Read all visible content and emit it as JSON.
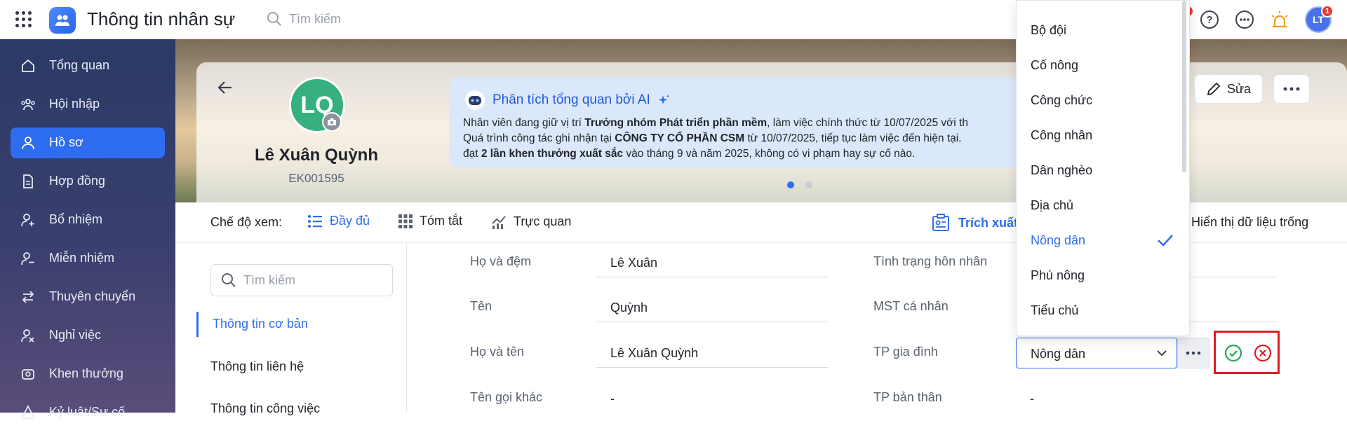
{
  "app": {
    "title": "Thông tin nhân sự",
    "search_placeholder": "Tìm kiếm",
    "notification_count": "1",
    "user_initials": "LT"
  },
  "sidebar": {
    "items": [
      {
        "label": "Tổng quan",
        "icon": "home-icon"
      },
      {
        "label": "Hội nhập",
        "icon": "team-icon"
      },
      {
        "label": "Hồ sơ",
        "icon": "user-icon",
        "active": true
      },
      {
        "label": "Hợp đồng",
        "icon": "document-icon"
      },
      {
        "label": "Bổ nhiệm",
        "icon": "user-plus-icon"
      },
      {
        "label": "Miễn nhiệm",
        "icon": "user-minus-icon"
      },
      {
        "label": "Thuyên chuyển",
        "icon": "transfer-icon"
      },
      {
        "label": "Nghỉ việc",
        "icon": "user-x-icon"
      },
      {
        "label": "Khen thưởng",
        "icon": "award-icon"
      },
      {
        "label": "Kỷ luật/Sự cố",
        "icon": "warning-icon"
      }
    ]
  },
  "profile": {
    "initials": "LQ",
    "name": "Lê Xuân Quỳnh",
    "code": "EK001595"
  },
  "ai": {
    "title": "Phân tích tổng quan bởi AI",
    "line1_a": "Nhân viên đang giữ vị trí ",
    "line1_b": "Trưởng nhóm Phát triển phần mềm",
    "line1_c": ", làm việc chính thức từ 10/07/2025 với th",
    "line2_a": "Quá trình công tác ghi nhận tại ",
    "line2_b": "CÔNG TY CỔ PHẦN CSM",
    "line2_c": " từ 10/07/2025, tiếp tục làm việc đến hiện tại.",
    "line3_a": "đạt ",
    "line3_b": "2 lần khen thưởng xuất sắc",
    "line3_c": " vào tháng 9 và năm 2025, không có vi phạm hay sự cố nào."
  },
  "actions": {
    "edit": "Sửa"
  },
  "viewbar": {
    "label": "Chế độ xem:",
    "full": "Đầy đủ",
    "summary": "Tóm tắt",
    "visual": "Trực quan",
    "extract": "Trích xuất",
    "show_empty": "Hiển thị dữ liệu trống"
  },
  "leftpanel": {
    "search_placeholder": "Tìm kiếm",
    "menu": [
      "Thông tin cơ bản",
      "Thông tin liên hệ",
      "Thông tin công việc"
    ]
  },
  "form": {
    "left": [
      {
        "label": "Họ và đệm",
        "value": "Lê Xuân"
      },
      {
        "label": "Tên",
        "value": "Quỳnh"
      },
      {
        "label": "Họ và tên",
        "value": "Lê Xuân Quỳnh"
      },
      {
        "label": "Tên gọi khác",
        "value": "-"
      }
    ],
    "right": [
      {
        "label": "Tình trạng hôn nhân",
        "value": ""
      },
      {
        "label": "MST cá nhân",
        "value": ""
      },
      {
        "label": "TP gia đình",
        "value": "Nông dân"
      },
      {
        "label": "TP bản thân",
        "value": "-"
      }
    ]
  },
  "dropdown": {
    "options": [
      "Bộ đội",
      "Cố nông",
      "Công chức",
      "Công nhân",
      "Dân nghèo",
      "Địa chủ",
      "Nông dân",
      "Phú nông",
      "Tiểu chủ"
    ],
    "selected": "Nông dân"
  },
  "colors": {
    "primary": "#2f6df0",
    "confirm": "#23a55a",
    "cancel": "#e01b24",
    "sidebar": "#2b3a66"
  }
}
